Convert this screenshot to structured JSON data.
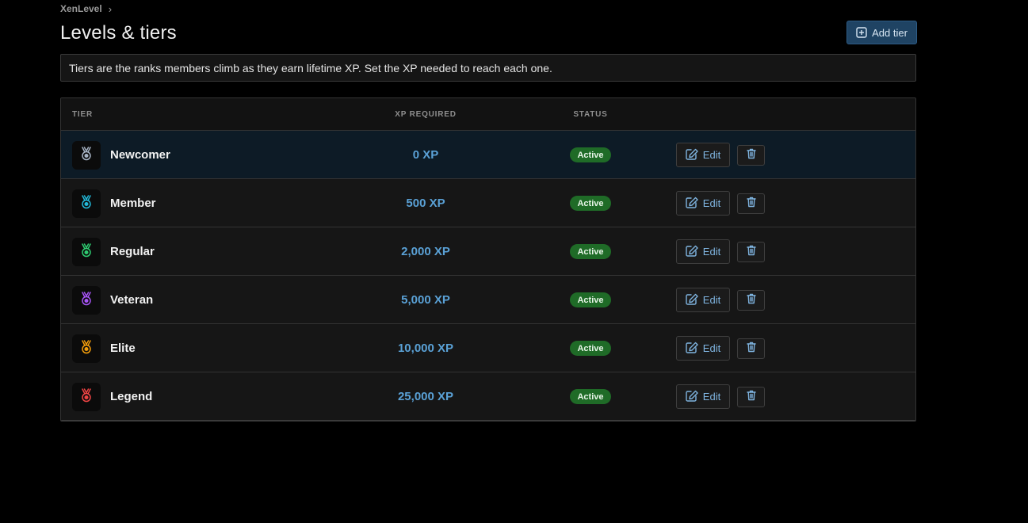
{
  "breadcrumb": {
    "root": "XenLevel",
    "separator": "›"
  },
  "page": {
    "title": "Levels & tiers",
    "description": "Tiers are the ranks members climb as they earn lifetime XP. Set the XP needed to reach each one."
  },
  "toolbar": {
    "add_label": "Add tier",
    "add_icon": "plus-square-icon"
  },
  "table": {
    "headers": {
      "tier": "TIER",
      "xp": "XP REQUIRED",
      "status": "STATUS"
    },
    "rows": [
      {
        "name": "Newcomer",
        "xp": "0 XP",
        "status": "Active",
        "edit_label": "Edit",
        "icon": "medal-icon",
        "icon_color": "#a7b3c4",
        "highlighted": true
      },
      {
        "name": "Member",
        "xp": "500 XP",
        "status": "Active",
        "edit_label": "Edit",
        "icon": "medal-icon",
        "icon_color": "#22b8d8",
        "highlighted": false
      },
      {
        "name": "Regular",
        "xp": "2,000 XP",
        "status": "Active",
        "edit_label": "Edit",
        "icon": "medal-icon",
        "icon_color": "#2ecc71",
        "highlighted": false
      },
      {
        "name": "Veteran",
        "xp": "5,000 XP",
        "status": "Active",
        "edit_label": "Edit",
        "icon": "medal-icon",
        "icon_color": "#a855f7",
        "highlighted": false
      },
      {
        "name": "Elite",
        "xp": "10,000 XP",
        "status": "Active",
        "edit_label": "Edit",
        "icon": "medal-icon",
        "icon_color": "#f59e0b",
        "highlighted": false
      },
      {
        "name": "Legend",
        "xp": "25,000 XP",
        "status": "Active",
        "edit_label": "Edit",
        "icon": "medal-icon",
        "icon_color": "#ef4444",
        "highlighted": false
      }
    ]
  },
  "colors": {
    "accent": "#5aa1d6",
    "status_active": "#1f6b27",
    "add_button_bg": "#1f4363"
  }
}
